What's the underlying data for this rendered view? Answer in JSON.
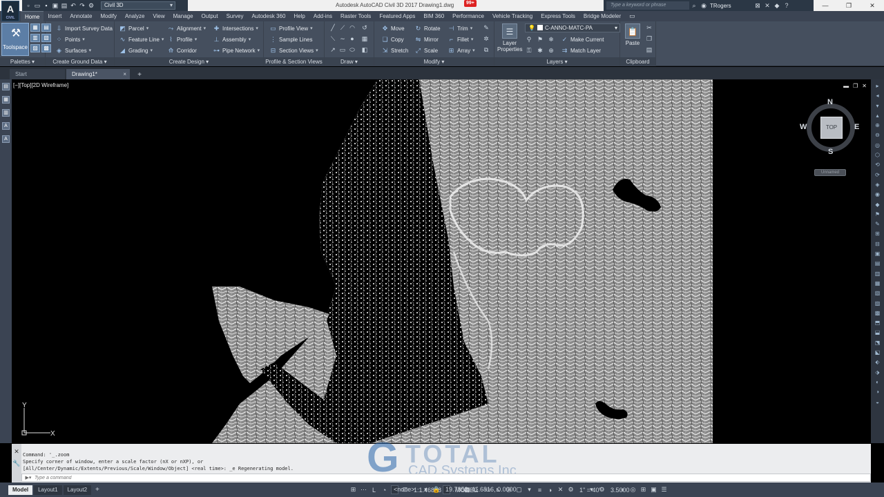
{
  "window": {
    "title": "Autodesk AutoCAD Civil 3D 2017   Drawing1.dwg",
    "notification_count": "99+",
    "app_logo": "A",
    "app_logo_sub": "CIVIL",
    "workspace": "Civil 3D",
    "search_placeholder": "Type a keyword or phrase",
    "user": "TRogers"
  },
  "ribbon_tabs": [
    "Home",
    "Insert",
    "Annotate",
    "Modify",
    "Analyze",
    "View",
    "Manage",
    "Output",
    "Survey",
    "Autodesk 360",
    "Help",
    "Add-ins",
    "Raster Tools",
    "Featured Apps",
    "BIM 360",
    "Performance",
    "Vehicle Tracking",
    "Express Tools",
    "Bridge Modeler"
  ],
  "ribbon": {
    "palettes": {
      "title": "Palettes",
      "toolspace": "Toolspace"
    },
    "create_ground_data": {
      "title": "Create Ground Data",
      "import_survey": "Import Survey Data",
      "points": "Points",
      "surfaces": "Surfaces"
    },
    "create_design": {
      "title": "Create Design",
      "parcel": "Parcel",
      "feature_line": "Feature Line",
      "grading": "Grading",
      "alignment": "Alignment",
      "profile": "Profile",
      "corridor": "Corridor",
      "intersections": "Intersections",
      "assembly": "Assembly",
      "pipe_network": "Pipe Network"
    },
    "profile_section": {
      "title": "Profile & Section Views",
      "profile_view": "Profile View",
      "sample_lines": "Sample Lines",
      "section_views": "Section Views"
    },
    "draw": {
      "title": "Draw"
    },
    "modify": {
      "title": "Modify",
      "move": "Move",
      "copy": "Copy",
      "stretch": "Stretch",
      "rotate": "Rotate",
      "mirror": "Mirror",
      "scale": "Scale",
      "trim": "Trim",
      "fillet": "Fillet",
      "array": "Array"
    },
    "layers": {
      "title": "Layers",
      "layer_properties": "Layer Properties",
      "current_layer": "C-ANNO-MATC-PA",
      "make_current": "Make Current",
      "match_layer": "Match Layer"
    },
    "clipboard": {
      "title": "Clipboard",
      "paste": "Paste"
    }
  },
  "doc_tabs": {
    "start": "Start",
    "drawing": "Drawing1*"
  },
  "viewport": {
    "label": "[−][Top][2D Wireframe]",
    "viewcube": {
      "top": "TOP",
      "n": "N",
      "s": "S",
      "e": "E",
      "w": "W"
    },
    "ucs_name": "Unnamed",
    "ucs_x": "X",
    "ucs_y": "Y"
  },
  "command": {
    "history": [
      "Command: '_.zoom",
      "Specify corner of window, enter a scale factor (nX or nXP), or",
      "[All/Center/Dynamic/Extents/Previous/Scale/Window/Object] <real time>: _e Regenerating model."
    ],
    "placeholder": "Type a command"
  },
  "watermark": {
    "line1": "TOTAL",
    "line2": "CAD Systems Inc"
  },
  "status": {
    "tabs": [
      "Model",
      "Layout1",
      "Layout2"
    ],
    "osnap": "<none>",
    "scale": "1:1.46828",
    "coords": "19.7853, 41.6816, 0.0000",
    "space": "MODEL",
    "annotation_scale": "1\" = 40'",
    "value": "3.5000"
  },
  "colors": {
    "ribbon_bg": "#454f5e",
    "tab_bar": "#3b4453",
    "viewport": "#000000",
    "terrain": "#d9d9d9"
  }
}
